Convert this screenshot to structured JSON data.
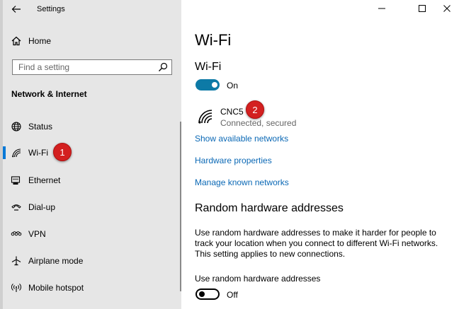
{
  "app": {
    "title": "Settings"
  },
  "sidebar": {
    "home_label": "Home",
    "search_placeholder": "Find a setting",
    "section_title": "Network & Internet",
    "items": [
      {
        "label": "Status",
        "icon": "globe-icon"
      },
      {
        "label": "Wi-Fi",
        "icon": "wifi-icon",
        "active": true
      },
      {
        "label": "Ethernet",
        "icon": "ethernet-icon"
      },
      {
        "label": "Dial-up",
        "icon": "dialup-icon"
      },
      {
        "label": "VPN",
        "icon": "vpn-icon"
      },
      {
        "label": "Airplane mode",
        "icon": "airplane-icon"
      },
      {
        "label": "Mobile hotspot",
        "icon": "hotspot-icon"
      }
    ]
  },
  "main": {
    "page_title": "Wi-Fi",
    "wifi_section_title": "Wi-Fi",
    "wifi_toggle_label": "On",
    "network": {
      "name": "CNC5",
      "status": "Connected, secured"
    },
    "links": {
      "show_networks": "Show available networks",
      "hardware_properties": "Hardware properties",
      "manage_networks": "Manage known networks"
    },
    "random_section_title": "Random hardware addresses",
    "random_description": "Use random hardware addresses to make it harder for people to track your location when you connect to different Wi-Fi networks. This setting applies to new connections.",
    "random_option_label": "Use random hardware addresses",
    "random_toggle_label": "Off"
  },
  "annotations": {
    "badge1": "1",
    "badge2": "2"
  },
  "colors": {
    "accent": "#0078d7",
    "toggle_on": "#0d7aa6",
    "link": "#0a68b5",
    "badge": "#d32020",
    "sidebar_bg": "#e6e6e6"
  }
}
